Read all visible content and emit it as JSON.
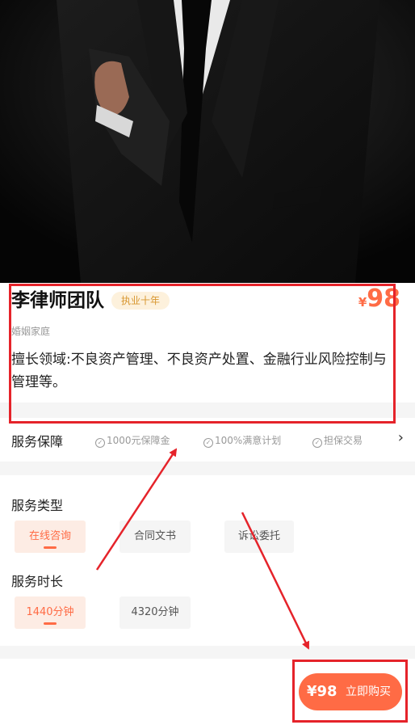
{
  "hero": {
    "image": "lawyer-in-black-suit-photo"
  },
  "profile": {
    "name": "李律师团队",
    "badge": "执业十年",
    "price_currency": "¥",
    "price_value": "98",
    "category": "婚姻家庭",
    "description": "擅长领域:不良资产管理、不良资产处置、金融行业风险控制与管理等。"
  },
  "guarantee": {
    "label": "服务保障",
    "items": [
      "1000元保障金",
      "100%满意计划",
      "担保交易"
    ],
    "check_icon": "check-circle-icon",
    "more_icon": "chevron-right-icon"
  },
  "service_type": {
    "label": "服务类型",
    "options": [
      "在线咨询",
      "合同文书",
      "诉讼委托"
    ],
    "selected": "在线咨询"
  },
  "service_duration": {
    "label": "服务时长",
    "options": [
      "1440分钟",
      "4320分钟"
    ],
    "selected": "1440分钟"
  },
  "buy_bar": {
    "price": "¥98",
    "button_label": "立即购买"
  },
  "colors": {
    "accent": "#ff6b45",
    "annotation": "#e5232a",
    "badge_bg": "#fdf1dc",
    "badge_text": "#d8962f"
  }
}
